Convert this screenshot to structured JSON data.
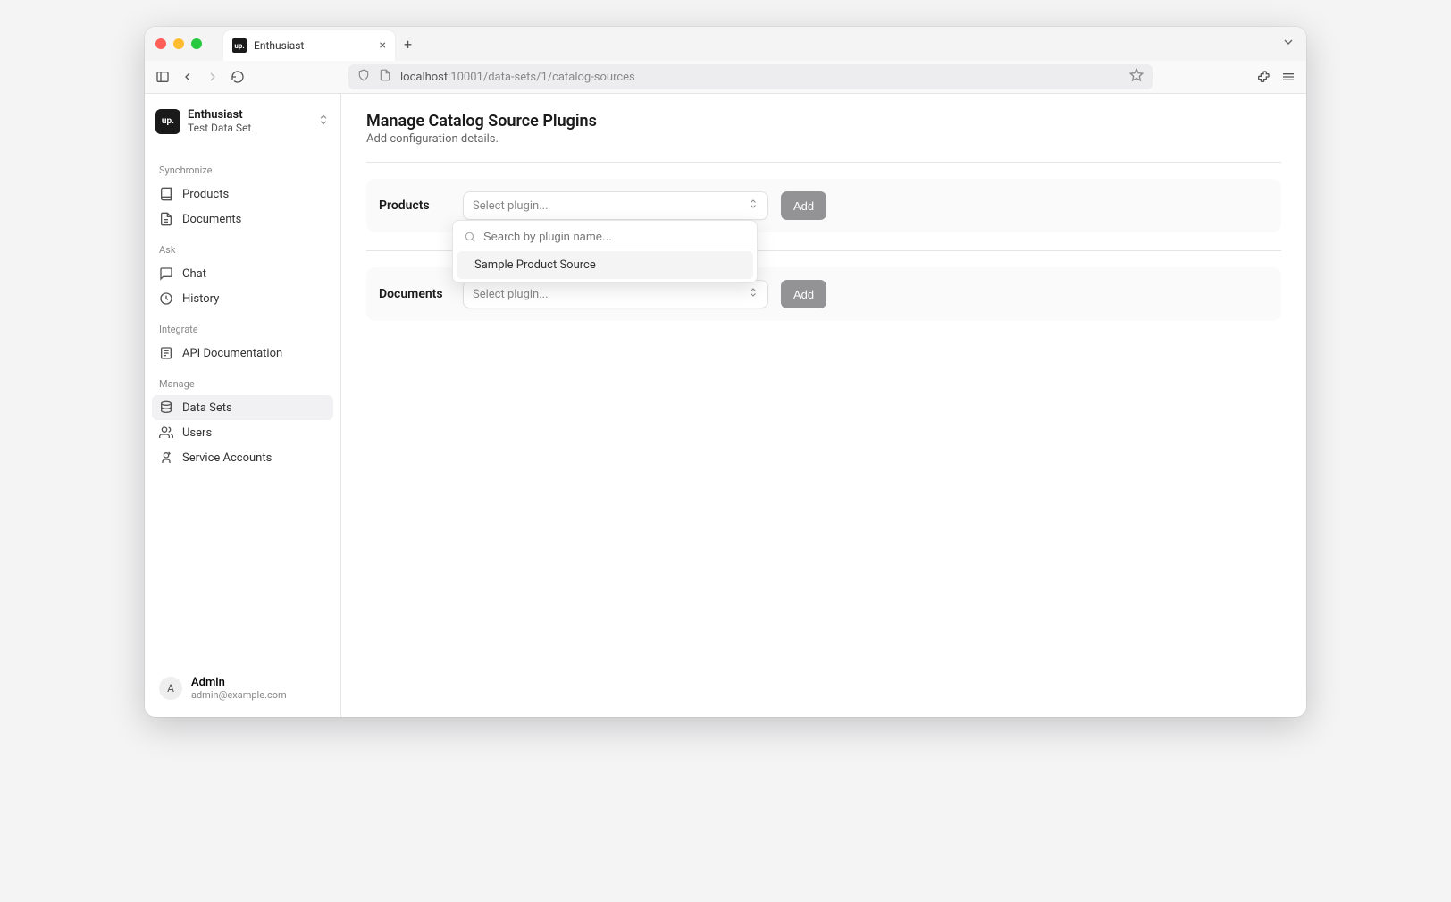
{
  "browser": {
    "tab_title": "Enthusiast",
    "favicon_text": "up.",
    "url_host": "localhost",
    "url_port_path": ":10001/data-sets/1/catalog-sources"
  },
  "sidebar": {
    "workspace": {
      "logo_text": "up.",
      "name": "Enthusiast",
      "subtitle": "Test Data Set"
    },
    "sections": {
      "sync": {
        "label": "Synchronize",
        "items": [
          {
            "label": "Products"
          },
          {
            "label": "Documents"
          }
        ]
      },
      "ask": {
        "label": "Ask",
        "items": [
          {
            "label": "Chat"
          },
          {
            "label": "History"
          }
        ]
      },
      "integrate": {
        "label": "Integrate",
        "items": [
          {
            "label": "API Documentation"
          }
        ]
      },
      "manage": {
        "label": "Manage",
        "items": [
          {
            "label": "Data Sets"
          },
          {
            "label": "Users"
          },
          {
            "label": "Service Accounts"
          }
        ]
      }
    },
    "user": {
      "initial": "A",
      "name": "Admin",
      "email": "admin@example.com"
    }
  },
  "main": {
    "title": "Manage Catalog Source Plugins",
    "subtitle": "Add configuration details.",
    "rows": {
      "products": {
        "label": "Products",
        "placeholder": "Select plugin...",
        "add_label": "Add",
        "search_placeholder": "Search by plugin name...",
        "option": "Sample Product Source"
      },
      "documents": {
        "label": "Documents",
        "placeholder": "Select plugin...",
        "add_label": "Add"
      }
    }
  }
}
